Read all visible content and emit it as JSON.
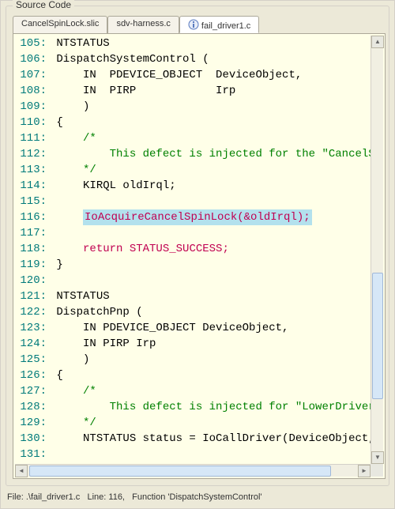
{
  "group_title": "Source Code",
  "tabs": [
    {
      "label": "CancelSpinLock.slic",
      "active": false,
      "icon": null
    },
    {
      "label": "sdv-harness.c",
      "active": false,
      "icon": null
    },
    {
      "label": "fail_driver1.c",
      "active": true,
      "icon": "info-icon"
    }
  ],
  "status": {
    "file": "File: .\\fail_driver1.c",
    "line": "Line: 116,",
    "func": "Function 'DispatchSystemControl'"
  },
  "source_lines": [
    {
      "n": 105,
      "tokens": [
        {
          "t": "NTSTATUS",
          "c": "plain"
        }
      ]
    },
    {
      "n": 106,
      "tokens": [
        {
          "t": "DispatchSystemControl (",
          "c": "plain"
        }
      ]
    },
    {
      "n": 107,
      "tokens": [
        {
          "t": "    IN  PDEVICE_OBJECT  DeviceObject,",
          "c": "plain"
        }
      ]
    },
    {
      "n": 108,
      "tokens": [
        {
          "t": "    IN  PIRP            Irp",
          "c": "plain"
        }
      ]
    },
    {
      "n": 109,
      "tokens": [
        {
          "t": "    )",
          "c": "plain"
        }
      ]
    },
    {
      "n": 110,
      "tokens": [
        {
          "t": "{",
          "c": "plain"
        }
      ]
    },
    {
      "n": 111,
      "tokens": [
        {
          "t": "    /*",
          "c": "comment"
        }
      ]
    },
    {
      "n": 112,
      "tokens": [
        {
          "t": "        This defect is injected for the \"CancelSpinL",
          "c": "comment"
        }
      ]
    },
    {
      "n": 113,
      "tokens": [
        {
          "t": "    */",
          "c": "comment"
        }
      ]
    },
    {
      "n": 114,
      "tokens": [
        {
          "t": "    KIRQL oldIrql;",
          "c": "plain"
        }
      ]
    },
    {
      "n": 115,
      "tokens": [
        {
          "t": "",
          "c": "plain"
        }
      ]
    },
    {
      "n": 116,
      "tokens": [
        {
          "t": "    ",
          "c": "plain"
        },
        {
          "t": "IoAcquireCancelSpinLock(&oldIrql);",
          "c": "highlight"
        }
      ]
    },
    {
      "n": 117,
      "tokens": [
        {
          "t": "",
          "c": "plain"
        }
      ]
    },
    {
      "n": 118,
      "tokens": [
        {
          "t": "    ",
          "c": "plain"
        },
        {
          "t": "return STATUS_SUCCESS;",
          "c": "return"
        }
      ]
    },
    {
      "n": 119,
      "tokens": [
        {
          "t": "}",
          "c": "plain"
        }
      ]
    },
    {
      "n": 120,
      "tokens": [
        {
          "t": "",
          "c": "plain"
        }
      ]
    },
    {
      "n": 121,
      "tokens": [
        {
          "t": "NTSTATUS",
          "c": "plain"
        }
      ]
    },
    {
      "n": 122,
      "tokens": [
        {
          "t": "DispatchPnp (",
          "c": "plain"
        }
      ]
    },
    {
      "n": 123,
      "tokens": [
        {
          "t": "    IN PDEVICE_OBJECT DeviceObject,",
          "c": "plain"
        }
      ]
    },
    {
      "n": 124,
      "tokens": [
        {
          "t": "    IN PIRP Irp",
          "c": "plain"
        }
      ]
    },
    {
      "n": 125,
      "tokens": [
        {
          "t": "    )",
          "c": "plain"
        }
      ]
    },
    {
      "n": 126,
      "tokens": [
        {
          "t": "{",
          "c": "plain"
        }
      ]
    },
    {
      "n": 127,
      "tokens": [
        {
          "t": "    /*",
          "c": "comment"
        }
      ]
    },
    {
      "n": 128,
      "tokens": [
        {
          "t": "        This defect is injected for \"LowerDriverRetu",
          "c": "comment"
        }
      ]
    },
    {
      "n": 129,
      "tokens": [
        {
          "t": "    */",
          "c": "comment"
        }
      ]
    },
    {
      "n": 130,
      "tokens": [
        {
          "t": "    NTSTATUS status = IoCallDriver(DeviceObject,Irp",
          "c": "plain"
        }
      ]
    },
    {
      "n": 131,
      "tokens": [
        {
          "t": "",
          "c": "plain"
        }
      ]
    }
  ]
}
